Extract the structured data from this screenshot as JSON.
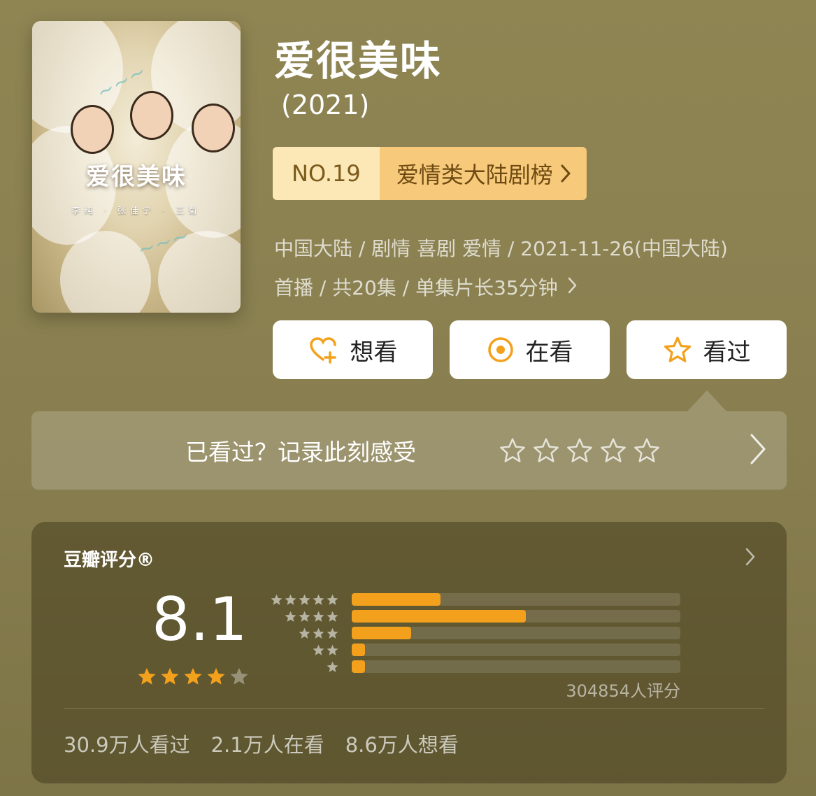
{
  "poster": {
    "title_text": "爱很美味",
    "cast_text": "李纯 · 张佳宁 · 王菊"
  },
  "show": {
    "title": "爱很美味",
    "year": "(2021)"
  },
  "ranking": {
    "no": "NO.19",
    "list": "爱情类大陆剧榜",
    "chevron": "›"
  },
  "meta": {
    "line1": "中国大陆 / 剧情 喜剧 爱情 / 2021-11-26(中国大陆)",
    "line2": "首播 / 共20集 / 单集片长35分钟"
  },
  "actions": [
    {
      "label": "想看",
      "icon": "heart-plus-icon"
    },
    {
      "label": "在看",
      "icon": "target-icon"
    },
    {
      "label": "看过",
      "icon": "star-outline-icon"
    }
  ],
  "record": {
    "label": "已看过？记录此刻感受",
    "stars": 5
  },
  "rating": {
    "title": "豆瓣评分®",
    "score": "8.1",
    "stars_filled": 4,
    "count_text": "304854人评分",
    "distribution": [
      {
        "stars": 5,
        "fraction": 0.27
      },
      {
        "stars": 4,
        "fraction": 0.53
      },
      {
        "stars": 3,
        "fraction": 0.18
      },
      {
        "stars": 2,
        "fraction": 0.04
      },
      {
        "stars": 1,
        "fraction": 0.04
      }
    ],
    "stats": {
      "watched": "30.9万人看过",
      "watching": "2.1万人在看",
      "want": "8.6万人想看"
    }
  },
  "colors": {
    "accent": "#f3a11c",
    "rank_bg": "#fbe8b6",
    "rank_list_bg": "#f6c97b"
  }
}
